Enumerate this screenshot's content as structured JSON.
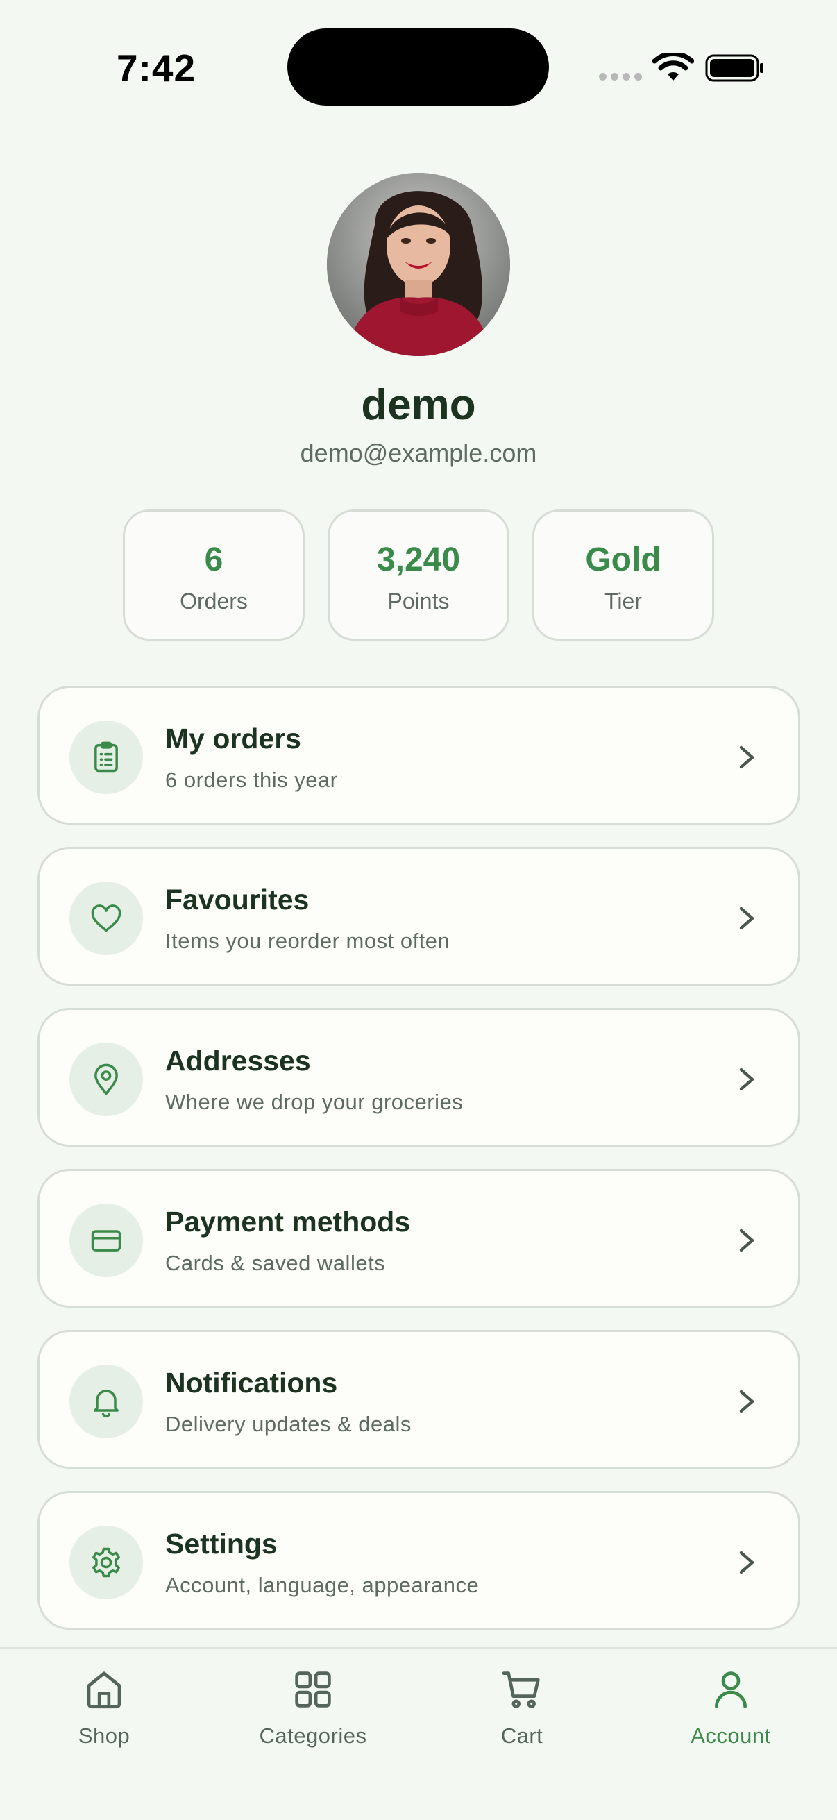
{
  "status_bar": {
    "time": "7:42"
  },
  "profile": {
    "name": "demo",
    "email": "demo@example.com"
  },
  "stats": [
    {
      "value": "6",
      "label": "Orders"
    },
    {
      "value": "3,240",
      "label": "Points"
    },
    {
      "value": "Gold",
      "label": "Tier"
    }
  ],
  "menu": [
    {
      "icon": "clipboard-icon",
      "title": "My orders",
      "subtitle": "6 orders this year"
    },
    {
      "icon": "heart-icon",
      "title": "Favourites",
      "subtitle": "Items you reorder most often"
    },
    {
      "icon": "map-pin-icon",
      "title": "Addresses",
      "subtitle": "Where we drop your groceries"
    },
    {
      "icon": "credit-card-icon",
      "title": "Payment methods",
      "subtitle": "Cards & saved wallets"
    },
    {
      "icon": "bell-icon",
      "title": "Notifications",
      "subtitle": "Delivery updates & deals"
    },
    {
      "icon": "gear-icon",
      "title": "Settings",
      "subtitle": "Account, language, appearance"
    }
  ],
  "tabs": [
    {
      "icon": "home-icon",
      "label": "Shop",
      "active": false
    },
    {
      "icon": "grid-icon",
      "label": "Categories",
      "active": false
    },
    {
      "icon": "cart-icon",
      "label": "Cart",
      "active": false
    },
    {
      "icon": "user-icon",
      "label": "Account",
      "active": true
    }
  ],
  "colors": {
    "background": "#f4f8f2",
    "accent": "#3a8a4a",
    "text_primary": "#1c3322",
    "text_secondary": "#5e6b62",
    "icon_bg": "#e6efe5",
    "card_border": "#d6ddd5"
  }
}
